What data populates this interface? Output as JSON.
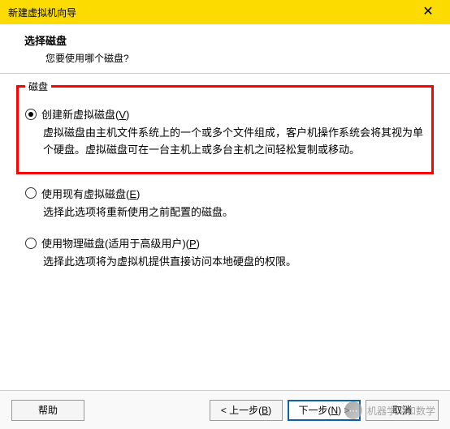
{
  "window": {
    "title": "新建虚拟机向导",
    "close_glyph": "✕"
  },
  "header": {
    "title": "选择磁盘",
    "subtitle": "您要使用哪个磁盘?"
  },
  "group": {
    "label": "磁盘"
  },
  "options": [
    {
      "label_pre": "创建新虚拟磁盘(",
      "label_key": "V",
      "label_post": ")",
      "selected": true,
      "desc": "虚拟磁盘由主机文件系统上的一个或多个文件组成，客户机操作系统会将其视为单个硬盘。虚拟磁盘可在一台主机上或多台主机之间轻松复制或移动。"
    },
    {
      "label_pre": "使用现有虚拟磁盘(",
      "label_key": "E",
      "label_post": ")",
      "selected": false,
      "desc": "选择此选项将重新使用之前配置的磁盘。"
    },
    {
      "label_pre": "使用物理磁盘(适用于高级用户)(",
      "label_key": "P",
      "label_post": ")",
      "selected": false,
      "desc": "选择此选项将为虚拟机提供直接访问本地硬盘的权限。"
    }
  ],
  "footer": {
    "help": "帮助",
    "back_pre": "< 上一步(",
    "back_key": "B",
    "back_post": ")",
    "next_pre": "下一步(",
    "next_key": "N",
    "next_post": ") >",
    "cancel": "取消"
  },
  "watermark": {
    "icon_glyph": "⋯",
    "text": "机器学习和数学"
  }
}
